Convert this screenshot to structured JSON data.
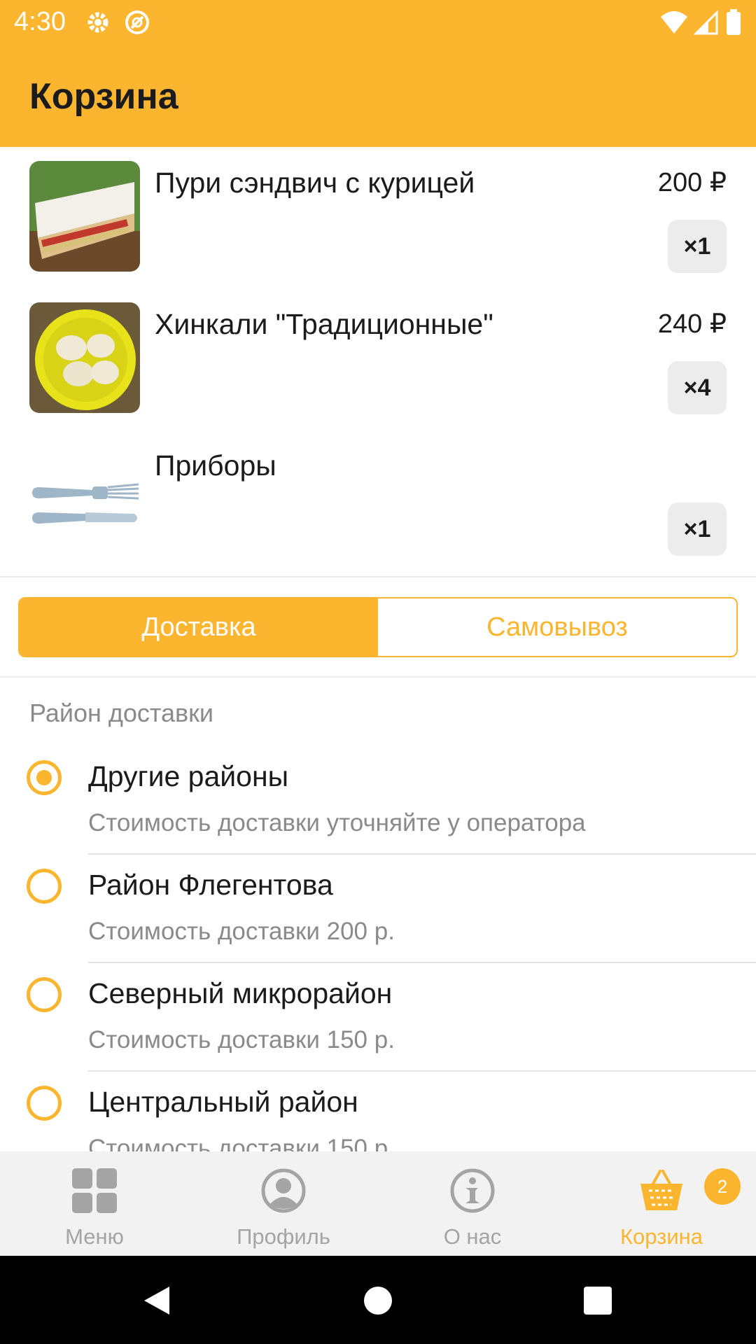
{
  "status_bar": {
    "time": "4:30"
  },
  "app_bar": {
    "title": "Корзина"
  },
  "cart_items": [
    {
      "name": "Пури сэндвич с курицей",
      "price": "200 ₽",
      "quantity": "×1"
    },
    {
      "name": "Хинкали \"Традиционные\"",
      "price": "240 ₽",
      "quantity": "×4"
    },
    {
      "name": "Приборы",
      "price": "",
      "quantity": "×1"
    }
  ],
  "delivery_toggle": {
    "delivery_label": "Доставка",
    "pickup_label": "Самовывоз",
    "selected": "delivery"
  },
  "district_section": {
    "label": "Район доставки",
    "options": [
      {
        "title": "Другие районы",
        "subtitle": "Стоимость доставки уточняйте у оператора",
        "checked": true
      },
      {
        "title": "Район Флегентова",
        "subtitle": "Стоимость доставки 200 р.",
        "checked": false
      },
      {
        "title": "Северный микрорайон",
        "subtitle": "Стоимость доставки 150 р.",
        "checked": false
      },
      {
        "title": "Центральный район",
        "subtitle": "Стоимость доставки 150 р.",
        "checked": false
      }
    ]
  },
  "bottom_nav": {
    "items": [
      {
        "label": "Меню",
        "icon": "grid-icon"
      },
      {
        "label": "Профиль",
        "icon": "profile-icon"
      },
      {
        "label": "О нас",
        "icon": "info-icon"
      },
      {
        "label": "Корзина",
        "icon": "basket-icon",
        "active": true
      }
    ],
    "cart_badge": "2"
  },
  "colors": {
    "accent": "#FBB52F",
    "muted": "#8a8a8a",
    "nav_bg": "#f2f2f2"
  }
}
